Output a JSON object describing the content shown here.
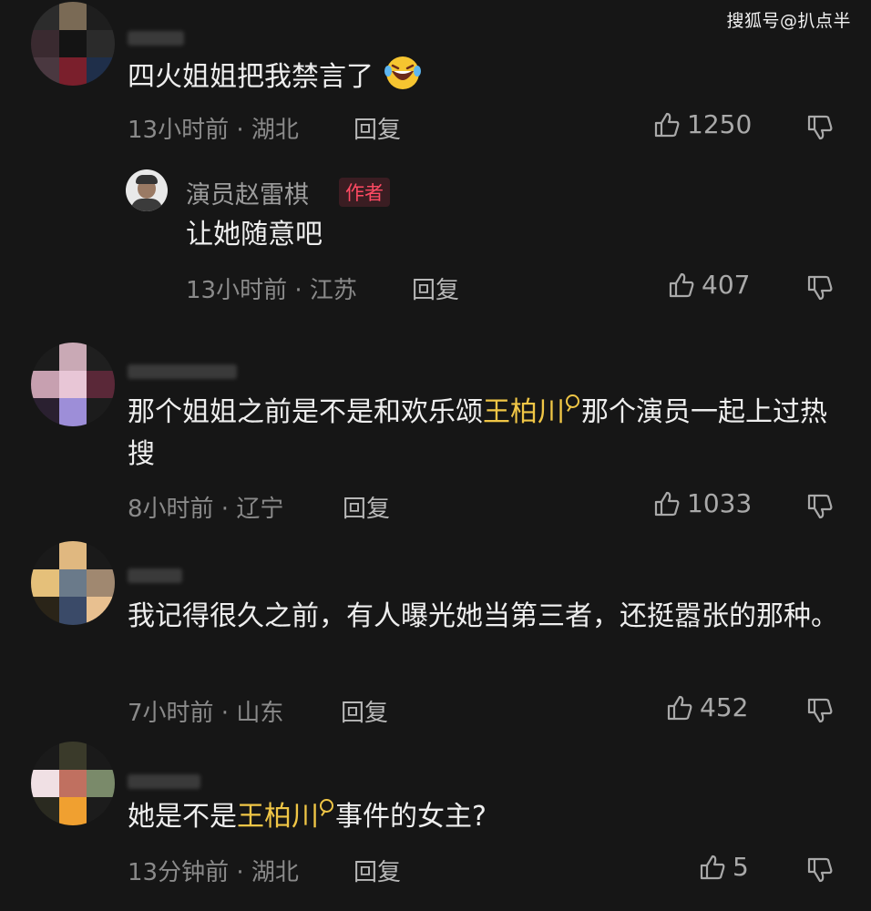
{
  "watermark": "搜狐号@扒点半",
  "icons": {
    "like": "thumbs-up-icon",
    "dislike": "thumbs-down-icon",
    "emoji": "laughing-tears-emoji",
    "search": "search-icon"
  },
  "colors": {
    "background": "#161616",
    "highlight": "#f0c646",
    "author_badge": "#ff4a63"
  },
  "comments": [
    {
      "text": "四火姐姐把我禁言了",
      "time_location": "13小时前 · 湖北",
      "reply_label": "回复",
      "likes": "1250",
      "reply": {
        "author": "演员赵雷棋",
        "badge": "作者",
        "text": "让她随意吧",
        "time_location": "13小时前 · 江苏",
        "reply_label": "回复",
        "likes": "407"
      }
    },
    {
      "text_before": "那个姐姐之前是不是和欢乐颂",
      "keyword": "王柏川",
      "text_after": "那个演员一起上过热搜",
      "time_location": "8小时前 · 辽宁",
      "reply_label": "回复",
      "likes": "1033"
    },
    {
      "text": "我记得很久之前，有人曝光她当第三者，还挺嚣张的那种。",
      "time_location": "7小时前 · 山东",
      "reply_label": "回复",
      "likes": "452"
    },
    {
      "text_before": "她是不是",
      "keyword": "王柏川",
      "text_after": "事件的女主?",
      "time_location": "13分钟前 · 湖北",
      "reply_label": "回复",
      "likes": "5"
    }
  ]
}
